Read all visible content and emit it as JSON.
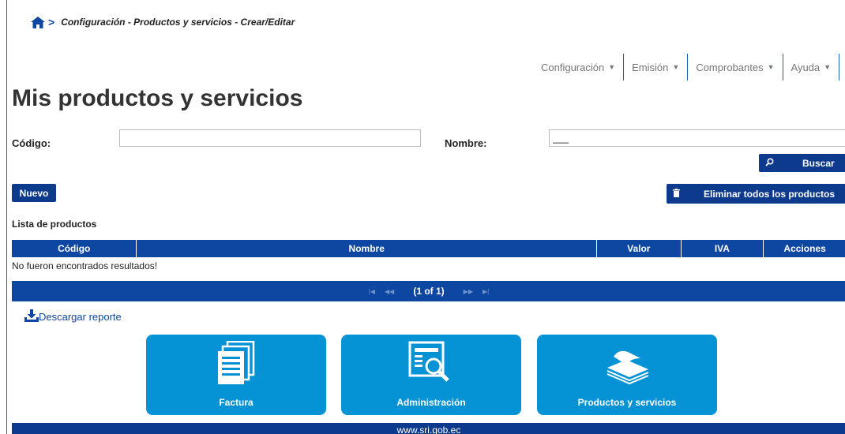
{
  "breadcrumb": {
    "separator": ">",
    "path": "Configuración - Productos y servicios - Crear/Editar"
  },
  "nav": {
    "items": [
      {
        "label": "Configuración"
      },
      {
        "label": "Emisión"
      },
      {
        "label": "Comprobantes"
      },
      {
        "label": "Ayuda"
      }
    ]
  },
  "page": {
    "title": "Mis productos y servicios"
  },
  "filters": {
    "codigo_label": "Código:",
    "codigo_value": "",
    "nombre_label": "Nombre:",
    "nombre_value": "___",
    "search_label": "Buscar"
  },
  "actions": {
    "new_label": "Nuevo",
    "delete_all_label": "Eliminar todos los productos"
  },
  "list": {
    "title": "Lista de productos",
    "columns": [
      "Código",
      "Nombre",
      "Valor",
      "IVA",
      "Acciones"
    ],
    "empty_message": "No fueron encontrados resultados!"
  },
  "pager": {
    "text": "(1 of 1)"
  },
  "download": {
    "label": "Descargar reporte"
  },
  "tiles": [
    {
      "label": "Factura",
      "icon": "documents-icon"
    },
    {
      "label": "Administración",
      "icon": "admin-search-icon"
    },
    {
      "label": "Productos y servicios",
      "icon": "papers-stack-icon"
    }
  ],
  "footer": {
    "text": "www.sri.gob.ec"
  },
  "colors": {
    "primary": "#0d47a1",
    "tile": "#0693d5",
    "dark": "#0d3a8c"
  }
}
